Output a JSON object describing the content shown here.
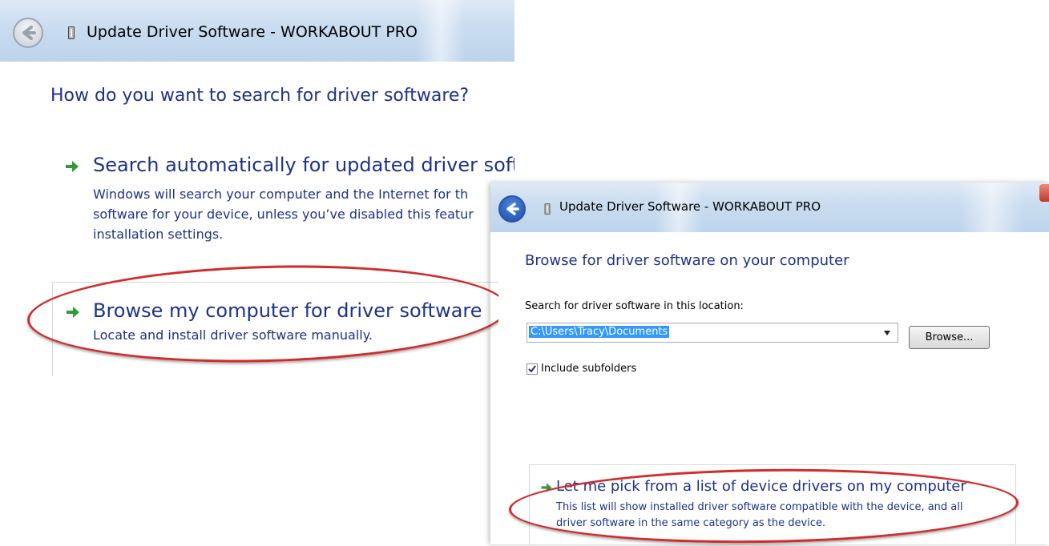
{
  "window1": {
    "title": "Update Driver Software - WORKABOUT PRO",
    "heading": "How do you want to search for driver software?",
    "option_auto": {
      "title": "Search automatically for updated driver soft",
      "desc_lines": [
        "Windows will search your computer and the Internet for th",
        "software for your device, unless you’ve disabled this featur",
        "installation settings."
      ]
    },
    "option_browse": {
      "title": "Browse my computer for driver software",
      "desc": "Locate and install driver software manually."
    }
  },
  "window2": {
    "title": "Update Driver Software - WORKABOUT PRO",
    "heading": "Browse for driver software on your computer",
    "location_label": "Search for driver software in this location:",
    "location_value": "C:\\Users\\Tracy\\Documents",
    "browse_label": "Browse...",
    "include_subfolders_label": "Include subfolders",
    "include_subfolders_checked": true,
    "option_pick": {
      "title": "Let me pick from a list of device drivers on my computer",
      "desc_lines": [
        "This list will show installed driver software compatible with the device, and all",
        "driver software in the same category as the device."
      ]
    }
  },
  "colors": {
    "heading_blue": "#1e3287",
    "arrow_green": "#2e9c3a",
    "highlight_red": "#d32b2b",
    "selection_blue": "#3399ff"
  },
  "icons": [
    "back-arrow-icon",
    "device-icon",
    "green-arrow-icon",
    "dropdown-arrow-icon",
    "checkbox-check-icon",
    "close-icon"
  ]
}
